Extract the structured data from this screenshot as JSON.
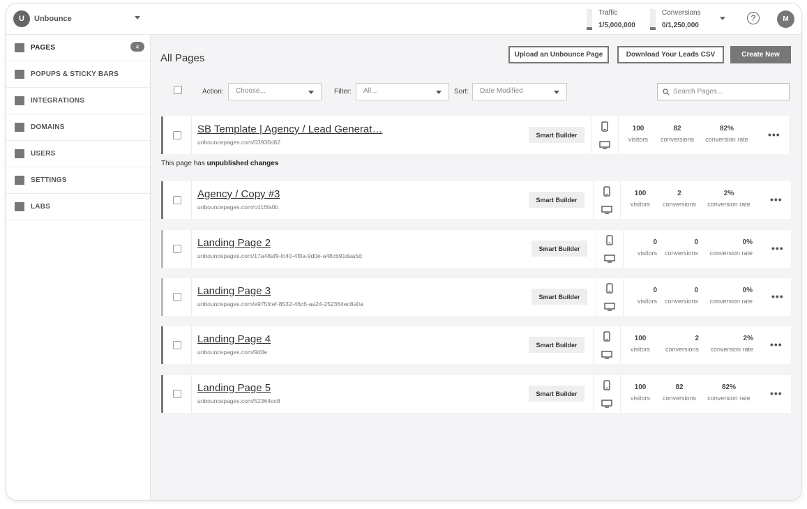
{
  "topbar": {
    "workspace_initial": "U",
    "workspace_name": "Unbounce",
    "traffic_label": "Traffic",
    "traffic_value": "1/5,000,000",
    "conversions_label": "Conversions",
    "conversions_value": "0/1,250,000",
    "help_symbol": "?",
    "user_initial": "M"
  },
  "sidebar": {
    "items": [
      {
        "label": "PAGES",
        "badge": "4"
      },
      {
        "label": "POPUPS & STICKY BARS"
      },
      {
        "label": "INTEGRATIONS"
      },
      {
        "label": "DOMAINS"
      },
      {
        "label": "USERS"
      },
      {
        "label": "SETTINGS"
      },
      {
        "label": "LABS"
      }
    ]
  },
  "main": {
    "title": "All Pages",
    "upload_button": "Upload an Unbounce Page",
    "download_button": "Download Your Leads CSV",
    "create_button": "Create New",
    "action_label": "Action:",
    "action_value": "Choose...",
    "filter_label": "Filter:",
    "filter_value": "All...",
    "sort_label": "Sort:",
    "sort_value": "Date Modified",
    "search_placeholder": "Search Pages...",
    "note_prefix": "This page has ",
    "note_bold": "unpublished changes"
  },
  "pages": [
    {
      "name": "SB Template | Agency / Lead Generat…",
      "url": "unbouncepages.com/03930d62",
      "builder": "Smart Builder",
      "visitors": "100",
      "conversions": "82",
      "rate": "82%"
    },
    {
      "name": "Agency / Copy #3",
      "url": "unbouncepages.com/c416fa0b",
      "builder": "Smart Builder",
      "visitors": "100",
      "conversions": "2",
      "rate": "2%"
    },
    {
      "name": "Landing Page 2",
      "url": "unbouncepages.com/17a48af9-fc40-4f0a-9d0e-a48cb91daa5d",
      "builder": "Smart Builder",
      "visitors": "0",
      "conversions": "0",
      "rate": "0%"
    },
    {
      "name": "Landing Page 3",
      "url": "unbouncepages.com/e975fcef-8532-46c6-aa24-252364ec8a0a",
      "builder": "Smart Builder",
      "visitors": "0",
      "conversions": "0",
      "rate": "0%"
    },
    {
      "name": "Landing Page 4",
      "url": "unbouncepages.com/9d0e",
      "builder": "Smart Builder",
      "visitors": "100",
      "conversions": "2",
      "rate": "2%"
    },
    {
      "name": "Landing Page 5",
      "url": "unbouncepages.com/52364ec8",
      "builder": "Smart Builder",
      "visitors": "100",
      "conversions": "82",
      "rate": "82%"
    }
  ],
  "stat_labels": {
    "visitors": "visitors",
    "conversions": "conversions",
    "rate": "conversion rate"
  },
  "more_symbol": "•••"
}
